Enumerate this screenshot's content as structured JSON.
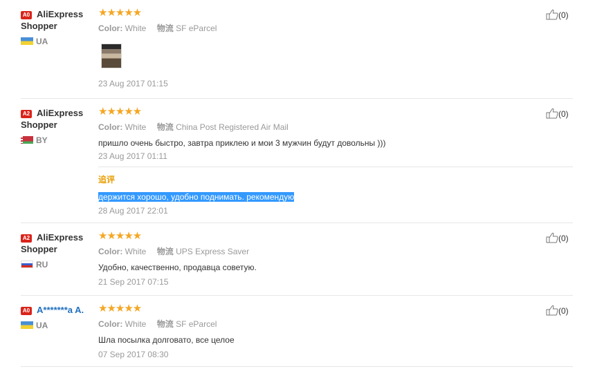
{
  "reviews": [
    {
      "badge": "A0",
      "username": "AliExpress Shopper",
      "country": "UA",
      "color_label": "Color:",
      "color_value": "White",
      "shipping_label": "物流",
      "shipping_value": "SF eParcel",
      "text": "",
      "date": "23 Aug 2017 01:15",
      "helpful": "(0)"
    },
    {
      "badge": "A2",
      "username": "AliExpress Shopper",
      "country": "BY",
      "color_label": "Color:",
      "color_value": "White",
      "shipping_label": "物流",
      "shipping_value": "China Post Registered Air Mail",
      "text": "пришло очень быстро, завтра приклею и мои 3 мужчин будут довольны )))",
      "date": "23 Aug 2017 01:11",
      "additional_title": "追评",
      "additional_text": "держится хорошо, удобно поднимать. рекомендую",
      "additional_date": "28 Aug 2017 22:01",
      "helpful": "(0)"
    },
    {
      "badge": "A2",
      "username": "AliExpress Shopper",
      "country": "RU",
      "color_label": "Color:",
      "color_value": "White",
      "shipping_label": "物流",
      "shipping_value": "UPS Express Saver",
      "text": "Удобно, качественно, продавца советую.",
      "date": "21 Sep 2017 07:15",
      "helpful": "(0)"
    },
    {
      "badge": "A0",
      "username": "A*******a A.",
      "country": "UA",
      "color_label": "Color:",
      "color_value": "White",
      "shipping_label": "物流",
      "shipping_value": "SF eParcel",
      "text": "Шла посылка долговато, все целое",
      "date": "07 Sep 2017 08:30",
      "helpful": "(0)"
    }
  ],
  "colors": {
    "star": "#f5a623",
    "badge": "#d9241b",
    "additional_title": "#e89c00",
    "selection": "#3399ff"
  },
  "icons": {
    "rating": "star-icon",
    "helpful": "thumbs-up-icon"
  }
}
